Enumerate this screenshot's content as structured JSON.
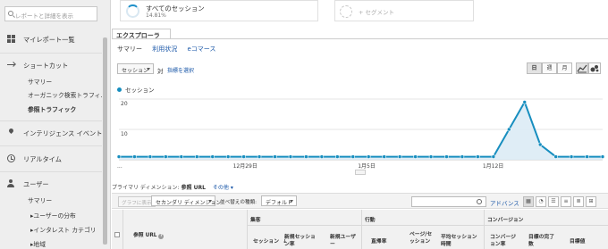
{
  "sidebar": {
    "search_placeholder": "レポートと詳細を表示",
    "my_reports": "マイレポート一覧",
    "shortcuts": "ショートカット",
    "shortcut_items": [
      "サマリー",
      "オーガニック検索トラフィ...",
      "参照トラフィック"
    ],
    "intelligence": "インテリジェンス イベント",
    "realtime": "リアルタイム",
    "audience": "ユーザー",
    "audience_items": [
      "サマリー",
      "▸ユーザーの分布",
      "▸インタレスト カテゴリ",
      "▸地域"
    ]
  },
  "segments": {
    "active_name": "すべてのセッション",
    "active_pct": "14.81%",
    "add_label": "+ セグメント"
  },
  "tabs": {
    "explorer": "エクスプローラ",
    "subtabs": [
      "サマリー",
      "利用状況",
      "eコマース"
    ]
  },
  "controls": {
    "metric_select": "セッション",
    "vs": "対",
    "pick_metric": "指標を選択",
    "granularity": [
      "日",
      "週",
      "月"
    ],
    "granularity_selected": "日"
  },
  "chart_data": {
    "type": "line",
    "series": [
      {
        "name": "セッション",
        "color": "#178ebf",
        "values": [
          1,
          1,
          1,
          1,
          1,
          1,
          1,
          1,
          1,
          1,
          1,
          1,
          1,
          1,
          1,
          1,
          1,
          1,
          1,
          1,
          1,
          1,
          1,
          1,
          1,
          10,
          19,
          5,
          1,
          1,
          1,
          1
        ]
      }
    ],
    "x_tick_labels": [
      "...",
      "12月29日",
      "1月5日",
      "1月12日"
    ],
    "x_tick_index": [
      0,
      8,
      16,
      24
    ],
    "y_tick_labels": [
      "20",
      "10"
    ],
    "ylim": [
      0,
      20
    ],
    "grid": true
  },
  "table": {
    "primary_dim_label": "プライマリ ディメンション:",
    "primary_dim_value": "参照 URL",
    "other": "その他 ▾",
    "plot_rows": "グラフに表示",
    "secondary_dim": "セカンダリ ディメンション",
    "sort_label": "並べ替えの種類:",
    "sort_value": "デフォルト",
    "advanced": "アドバンス",
    "col_main": "参照 URL",
    "groups": [
      "集客",
      "行動",
      "コンバージョン"
    ],
    "columns": {
      "sessions": "セッション",
      "new_sessions_rate": "新規セッション率",
      "new_users": "新規ユーザー",
      "bounce_rate": "直帰率",
      "pages_per_session": "ページ/セッション",
      "avg_duration": "平均セッション時間",
      "conv_rate": "コンバージョン率",
      "goal_completions": "目標の完了数",
      "goal_value": "目標値"
    }
  }
}
